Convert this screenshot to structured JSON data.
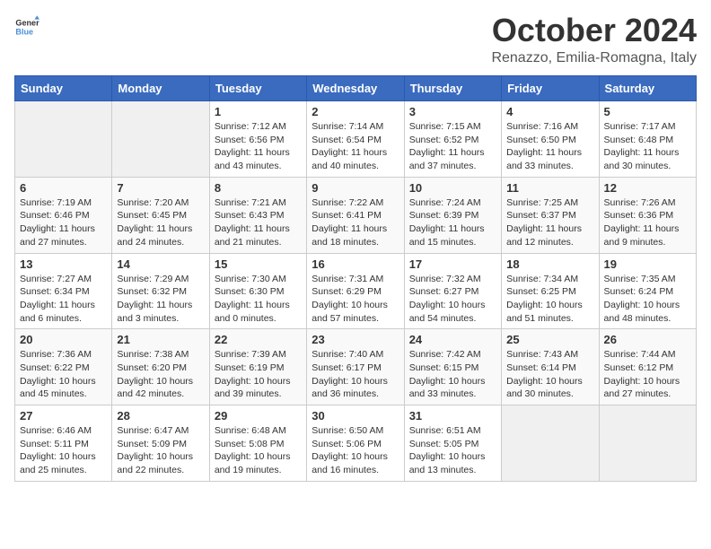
{
  "logo": {
    "line1": "General",
    "line2": "Blue"
  },
  "title": "October 2024",
  "subtitle": "Renazzo, Emilia-Romagna, Italy",
  "days_of_week": [
    "Sunday",
    "Monday",
    "Tuesday",
    "Wednesday",
    "Thursday",
    "Friday",
    "Saturday"
  ],
  "weeks": [
    [
      {
        "day": "",
        "detail": ""
      },
      {
        "day": "",
        "detail": ""
      },
      {
        "day": "1",
        "detail": "Sunrise: 7:12 AM\nSunset: 6:56 PM\nDaylight: 11 hours and 43 minutes."
      },
      {
        "day": "2",
        "detail": "Sunrise: 7:14 AM\nSunset: 6:54 PM\nDaylight: 11 hours and 40 minutes."
      },
      {
        "day": "3",
        "detail": "Sunrise: 7:15 AM\nSunset: 6:52 PM\nDaylight: 11 hours and 37 minutes."
      },
      {
        "day": "4",
        "detail": "Sunrise: 7:16 AM\nSunset: 6:50 PM\nDaylight: 11 hours and 33 minutes."
      },
      {
        "day": "5",
        "detail": "Sunrise: 7:17 AM\nSunset: 6:48 PM\nDaylight: 11 hours and 30 minutes."
      }
    ],
    [
      {
        "day": "6",
        "detail": "Sunrise: 7:19 AM\nSunset: 6:46 PM\nDaylight: 11 hours and 27 minutes."
      },
      {
        "day": "7",
        "detail": "Sunrise: 7:20 AM\nSunset: 6:45 PM\nDaylight: 11 hours and 24 minutes."
      },
      {
        "day": "8",
        "detail": "Sunrise: 7:21 AM\nSunset: 6:43 PM\nDaylight: 11 hours and 21 minutes."
      },
      {
        "day": "9",
        "detail": "Sunrise: 7:22 AM\nSunset: 6:41 PM\nDaylight: 11 hours and 18 minutes."
      },
      {
        "day": "10",
        "detail": "Sunrise: 7:24 AM\nSunset: 6:39 PM\nDaylight: 11 hours and 15 minutes."
      },
      {
        "day": "11",
        "detail": "Sunrise: 7:25 AM\nSunset: 6:37 PM\nDaylight: 11 hours and 12 minutes."
      },
      {
        "day": "12",
        "detail": "Sunrise: 7:26 AM\nSunset: 6:36 PM\nDaylight: 11 hours and 9 minutes."
      }
    ],
    [
      {
        "day": "13",
        "detail": "Sunrise: 7:27 AM\nSunset: 6:34 PM\nDaylight: 11 hours and 6 minutes."
      },
      {
        "day": "14",
        "detail": "Sunrise: 7:29 AM\nSunset: 6:32 PM\nDaylight: 11 hours and 3 minutes."
      },
      {
        "day": "15",
        "detail": "Sunrise: 7:30 AM\nSunset: 6:30 PM\nDaylight: 11 hours and 0 minutes."
      },
      {
        "day": "16",
        "detail": "Sunrise: 7:31 AM\nSunset: 6:29 PM\nDaylight: 10 hours and 57 minutes."
      },
      {
        "day": "17",
        "detail": "Sunrise: 7:32 AM\nSunset: 6:27 PM\nDaylight: 10 hours and 54 minutes."
      },
      {
        "day": "18",
        "detail": "Sunrise: 7:34 AM\nSunset: 6:25 PM\nDaylight: 10 hours and 51 minutes."
      },
      {
        "day": "19",
        "detail": "Sunrise: 7:35 AM\nSunset: 6:24 PM\nDaylight: 10 hours and 48 minutes."
      }
    ],
    [
      {
        "day": "20",
        "detail": "Sunrise: 7:36 AM\nSunset: 6:22 PM\nDaylight: 10 hours and 45 minutes."
      },
      {
        "day": "21",
        "detail": "Sunrise: 7:38 AM\nSunset: 6:20 PM\nDaylight: 10 hours and 42 minutes."
      },
      {
        "day": "22",
        "detail": "Sunrise: 7:39 AM\nSunset: 6:19 PM\nDaylight: 10 hours and 39 minutes."
      },
      {
        "day": "23",
        "detail": "Sunrise: 7:40 AM\nSunset: 6:17 PM\nDaylight: 10 hours and 36 minutes."
      },
      {
        "day": "24",
        "detail": "Sunrise: 7:42 AM\nSunset: 6:15 PM\nDaylight: 10 hours and 33 minutes."
      },
      {
        "day": "25",
        "detail": "Sunrise: 7:43 AM\nSunset: 6:14 PM\nDaylight: 10 hours and 30 minutes."
      },
      {
        "day": "26",
        "detail": "Sunrise: 7:44 AM\nSunset: 6:12 PM\nDaylight: 10 hours and 27 minutes."
      }
    ],
    [
      {
        "day": "27",
        "detail": "Sunrise: 6:46 AM\nSunset: 5:11 PM\nDaylight: 10 hours and 25 minutes."
      },
      {
        "day": "28",
        "detail": "Sunrise: 6:47 AM\nSunset: 5:09 PM\nDaylight: 10 hours and 22 minutes."
      },
      {
        "day": "29",
        "detail": "Sunrise: 6:48 AM\nSunset: 5:08 PM\nDaylight: 10 hours and 19 minutes."
      },
      {
        "day": "30",
        "detail": "Sunrise: 6:50 AM\nSunset: 5:06 PM\nDaylight: 10 hours and 16 minutes."
      },
      {
        "day": "31",
        "detail": "Sunrise: 6:51 AM\nSunset: 5:05 PM\nDaylight: 10 hours and 13 minutes."
      },
      {
        "day": "",
        "detail": ""
      },
      {
        "day": "",
        "detail": ""
      }
    ]
  ]
}
